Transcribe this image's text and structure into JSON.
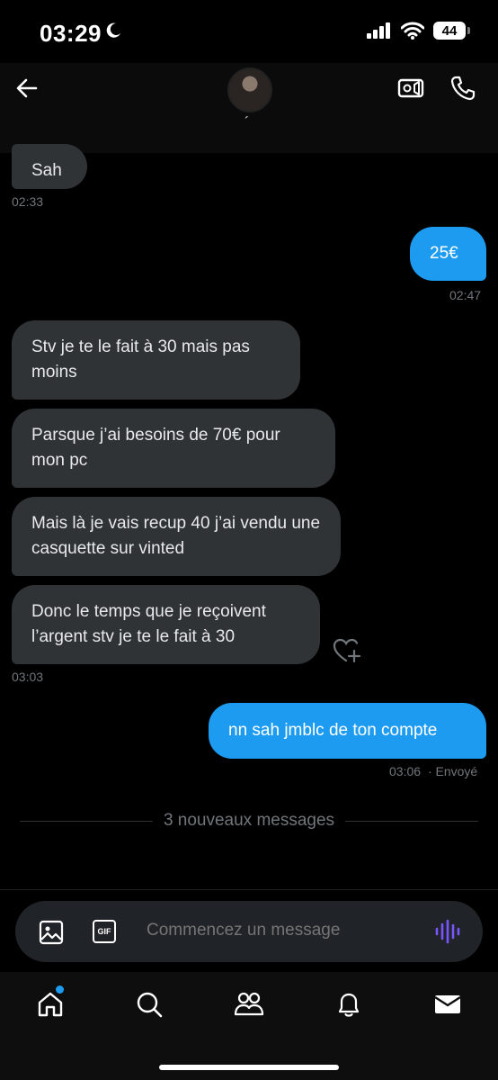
{
  "status": {
    "time": "03:29",
    "battery": "44"
  },
  "header": {
    "name_mark": "´"
  },
  "messages": [
    {
      "dir": "in",
      "text": "Sah"
    },
    {
      "dir": "out",
      "text": "25€"
    },
    {
      "dir": "in",
      "text": "Stv je te le fait à 30 mais pas moins"
    },
    {
      "dir": "in",
      "text": "Parsque j’ai besoins de 70€ pour mon pc"
    },
    {
      "dir": "in",
      "text": "Mais là je vais recup 40 j’ai vendu une casquette sur vinted"
    },
    {
      "dir": "in",
      "text": "Donc le temps que je reçoivent l’argent stv je te le fait à 30"
    },
    {
      "dir": "out",
      "text": "nn sah jmblc de ton compte"
    }
  ],
  "timestamps": {
    "t1": "02:33",
    "t2": "02:47",
    "t3": "03:03",
    "t4": "03:06",
    "t4_status": "· Envoyé"
  },
  "divider": {
    "label": "3 nouveaux messages"
  },
  "composer": {
    "placeholder": "Commencez un message",
    "gif_label": "GIF"
  },
  "colors": {
    "accent": "#1d9bf0",
    "bubble_in": "#2f3336",
    "background": "#000000"
  },
  "icons": [
    "back-arrow-icon",
    "video-call-icon",
    "phone-icon",
    "image-icon",
    "gif-icon",
    "voice-wave-icon",
    "home-icon",
    "search-icon",
    "communities-icon",
    "bell-icon",
    "mail-icon",
    "heart-plus-icon"
  ]
}
